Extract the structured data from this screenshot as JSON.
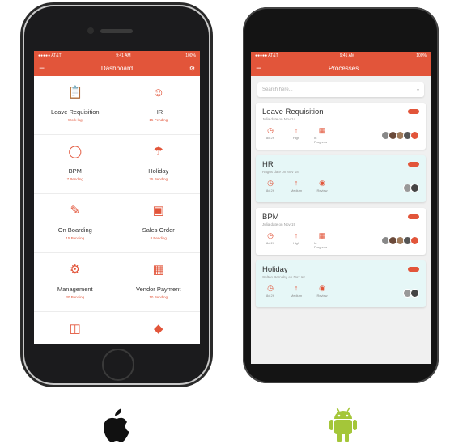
{
  "ios": {
    "status": {
      "carrier": "●●●●● AT&T",
      "time": "9:41 AM",
      "battery": "100%"
    },
    "title": "Dashboard",
    "tiles": [
      {
        "icon": "document-icon",
        "label": "Leave Requisition",
        "sub": "Work log"
      },
      {
        "icon": "person-icon",
        "label": "HR",
        "sub": "15 Pending"
      },
      {
        "icon": "bulb-icon",
        "label": "BPM",
        "sub": "7 Pending"
      },
      {
        "icon": "beach-icon",
        "label": "Holiday",
        "sub": "25 Pending"
      },
      {
        "icon": "onboarding-icon",
        "label": "On Boarding",
        "sub": "15 Pending"
      },
      {
        "icon": "chart-icon",
        "label": "Sales Order",
        "sub": "8 Pending"
      },
      {
        "icon": "gear-icon",
        "label": "Management",
        "sub": "30 Pending"
      },
      {
        "icon": "wallet-icon",
        "label": "Vendor Payment",
        "sub": "10 Pending"
      },
      {
        "icon": "cart-icon",
        "label": "",
        "sub": ""
      },
      {
        "icon": "tag-icon",
        "label": "",
        "sub": ""
      }
    ]
  },
  "android": {
    "status": {
      "carrier": "●●●●● AT&T",
      "time": "9:41 AM",
      "battery": "100%"
    },
    "title": "Processes",
    "search_placeholder": "Search here...",
    "cards": [
      {
        "title": "Leave Requisition",
        "subtitle": "Julia date on Nov 14",
        "bg": "white",
        "metas": [
          {
            "icon": "clock-icon",
            "text": "8d 2h"
          },
          {
            "icon": "arrow-up-icon",
            "text": "High"
          },
          {
            "icon": "chart-icon",
            "text": "In Progress"
          }
        ],
        "avatars": 5
      },
      {
        "title": "HR",
        "subtitle": "Ragus date on Nov 18",
        "bg": "teal",
        "metas": [
          {
            "icon": "clock-icon",
            "text": "8d 2h"
          },
          {
            "icon": "arrow-up-icon",
            "text": "Medium"
          },
          {
            "icon": "eye-icon",
            "text": "Review"
          }
        ],
        "avatars": 2
      },
      {
        "title": "BPM",
        "subtitle": "Julia date on Nov 19",
        "bg": "white",
        "metas": [
          {
            "icon": "clock-icon",
            "text": "8d 2h"
          },
          {
            "icon": "arrow-up-icon",
            "text": "High"
          },
          {
            "icon": "chart-icon",
            "text": "In Progress"
          }
        ],
        "avatars": 5
      },
      {
        "title": "Holiday",
        "subtitle": "Coltan Barnaby on Nov 12",
        "bg": "teal",
        "metas": [
          {
            "icon": "clock-icon",
            "text": "8d 2h"
          },
          {
            "icon": "arrow-up-icon",
            "text": "Medium"
          },
          {
            "icon": "eye-icon",
            "text": "Review"
          }
        ],
        "avatars": 2
      }
    ]
  },
  "colors": {
    "accent": "#e2553a",
    "teal_card": "#e6f7f7",
    "android_green": "#a4c639"
  }
}
